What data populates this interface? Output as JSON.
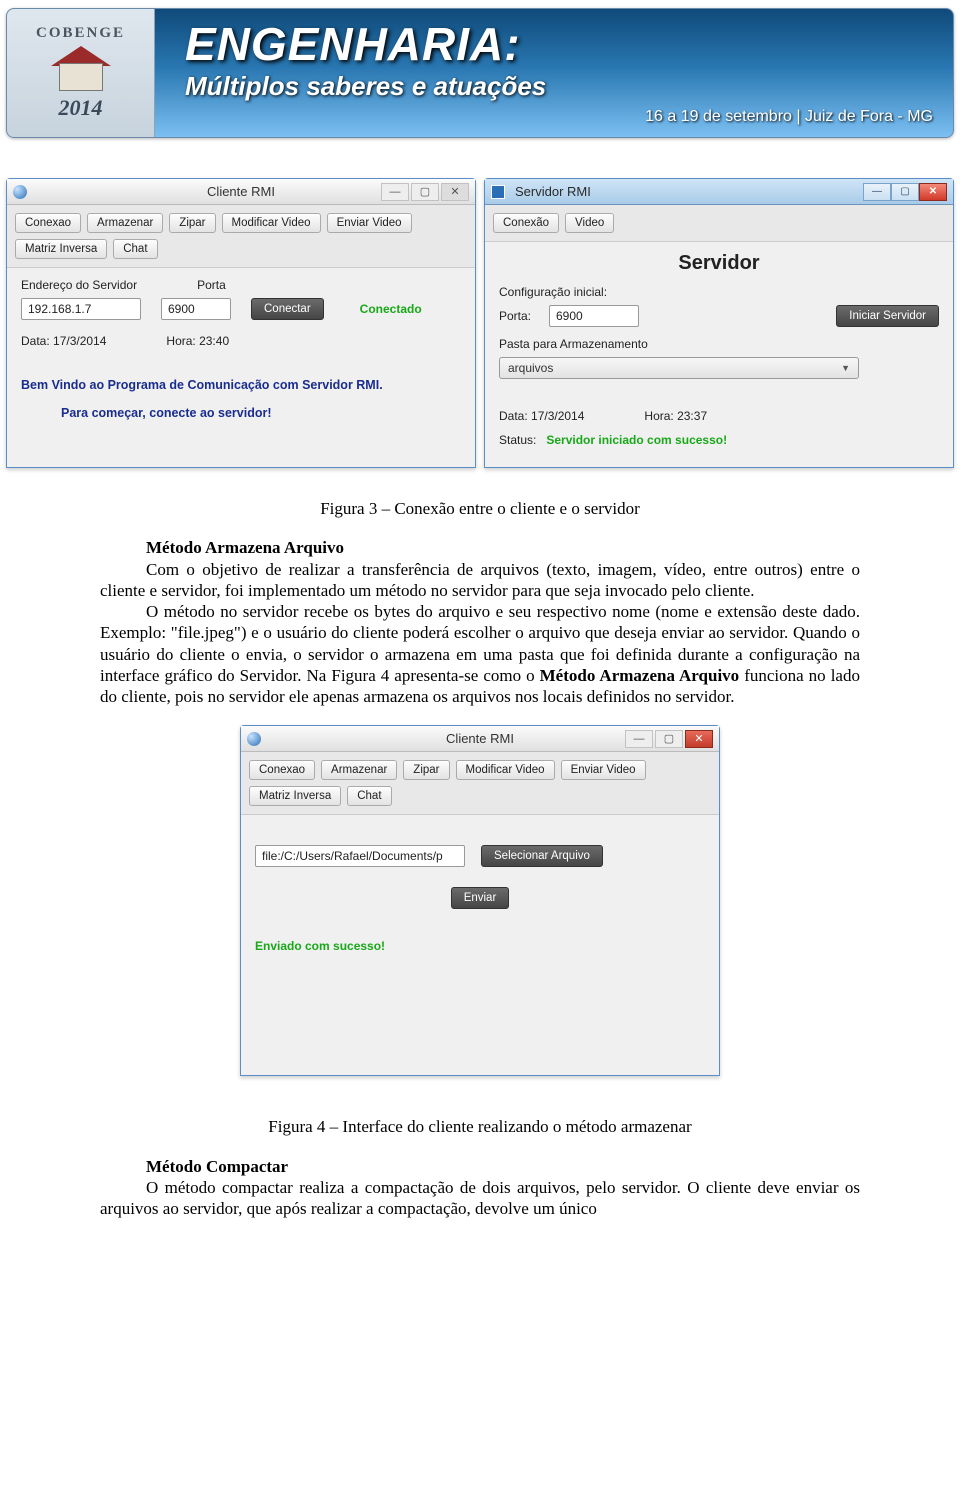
{
  "banner": {
    "org": "COBENGE",
    "year": "2014",
    "title": "ENGENHARIA:",
    "subtitle": "Múltiplos saberes e atuações",
    "dateline": "16 a 19 de setembro | Juiz de Fora - MG"
  },
  "client_win": {
    "title": "Cliente RMI",
    "tabs": [
      "Conexao",
      "Armazenar",
      "Zipar",
      "Modificar Video",
      "Enviar Video",
      "Matriz Inversa",
      "Chat"
    ],
    "endereco_lbl": "Endereço do Servidor",
    "porta_lbl": "Porta",
    "endereco_val": "192.168.1.7",
    "porta_val": "6900",
    "conectar_btn": "Conectar",
    "status": "Conectado",
    "data_lbl": "Data: 17/3/2014",
    "hora_lbl": "Hora: 23:40",
    "welcome1": "Bem Vindo ao Programa de Comunicação com Servidor RMI.",
    "welcome2": "Para começar, conecte ao servidor!"
  },
  "server_win": {
    "title": "Servidor RMI",
    "tabs": [
      "Conexão",
      "Video"
    ],
    "heading": "Servidor",
    "config_lbl": "Configuração inicial:",
    "porta_lbl": "Porta:",
    "porta_val": "6900",
    "start_btn": "Iniciar Servidor",
    "pasta_lbl": "Pasta para Armazenamento",
    "pasta_val": "arquivos",
    "data_lbl": "Data: 17/3/2014",
    "hora_lbl": "Hora: 23:37",
    "status_lbl": "Status:",
    "status_val": "Servidor iniciado com sucesso!"
  },
  "article": {
    "caption1": "Figura 3 – Conexão entre o cliente e o servidor",
    "h1": "Método Armazena Arquivo",
    "p1a": "Com o objetivo de realizar a transferência de arquivos (texto, imagem, vídeo, entre outros) entre o cliente e servidor, foi implementado um método no servidor para que seja invocado pelo cliente.",
    "p1b": "O método no servidor recebe os bytes do arquivo e seu respectivo nome (nome e extensão deste dado. Exemplo: \"file.jpeg\") e o usuário do cliente poderá escolher o arquivo que deseja enviar ao servidor. Quando o usuário do cliente o envia, o servidor o armazena em uma pasta que foi definida durante a configuração na interface gráfico do Servidor. Na Figura 4 apresenta-se como o ",
    "p1b_bold": "Método Armazena Arquivo",
    "p1b_tail": " funciona no lado do cliente, pois no servidor ele apenas armazena os arquivos nos locais definidos no servidor.",
    "caption2": "Figura 4 – Interface do cliente realizando o método armazenar",
    "h2": "Método Compactar",
    "p2": "O método compactar realiza a compactação de dois arquivos, pelo servidor. O cliente deve enviar os arquivos ao servidor, que após realizar a compactação, devolve um único"
  },
  "client_win2": {
    "title": "Cliente RMI",
    "tabs": [
      "Conexao",
      "Armazenar",
      "Zipar",
      "Modificar Video",
      "Enviar Video",
      "Matriz Inversa",
      "Chat"
    ],
    "path_val": "file:/C:/Users/Rafael/Documents/p",
    "select_btn": "Selecionar Arquivo",
    "send_btn": "Enviar",
    "status": "Enviado com sucesso!"
  }
}
